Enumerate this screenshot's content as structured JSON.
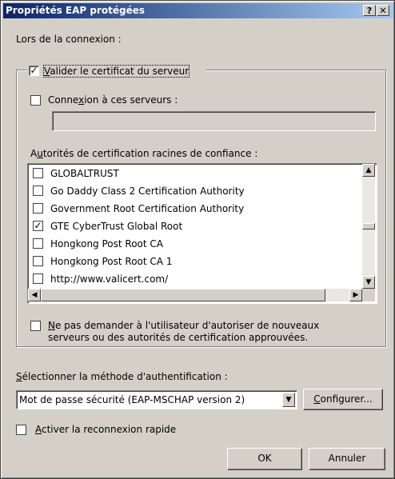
{
  "window": {
    "title": "Propriétés EAP protégées",
    "help_button": "?",
    "close_button": "✕"
  },
  "connection_label": "Lors de la connexion :",
  "validate_certificate": {
    "checked": true,
    "label_underlined": "V",
    "label_rest": "alider le certificat du serveur"
  },
  "connect_servers": {
    "checked": false,
    "label_pre": "Conne",
    "label_underlined": "x",
    "label_post": "ion à ces serveurs :",
    "value": ""
  },
  "trusted_roots": {
    "label_pre": "A",
    "label_underlined": "u",
    "label_post": "torités de certification racines de confiance :",
    "items": [
      {
        "label": "GLOBALTRUST",
        "checked": false
      },
      {
        "label": "Go Daddy Class 2 Certification Authority",
        "checked": false
      },
      {
        "label": "Government Root Certification Authority",
        "checked": false
      },
      {
        "label": "GTE CyberTrust Global Root",
        "checked": true
      },
      {
        "label": "Hongkong Post Root CA",
        "checked": false
      },
      {
        "label": "Hongkong Post Root CA 1",
        "checked": false
      },
      {
        "label": "http://www.valicert.com/",
        "checked": false
      }
    ]
  },
  "no_prompt": {
    "checked": false,
    "line1_underlined": "N",
    "line1_rest": "e pas demander à l'utilisateur d'autoriser de nouveaux",
    "line2": "serveurs ou des autorités de certification approuvées."
  },
  "auth_method": {
    "label_underlined": "S",
    "label_rest": "électionner la méthode d'authentification :",
    "selected": "Mot de passe sécurité (EAP-MSCHAP version 2)",
    "configure_underlined": "C",
    "configure_rest": "onfigurer..."
  },
  "fast_reconnect": {
    "checked": false,
    "label_underlined": "A",
    "label_rest": "ctiver la reconnexion rapide"
  },
  "buttons": {
    "ok": "OK",
    "cancel": "Annuler"
  }
}
